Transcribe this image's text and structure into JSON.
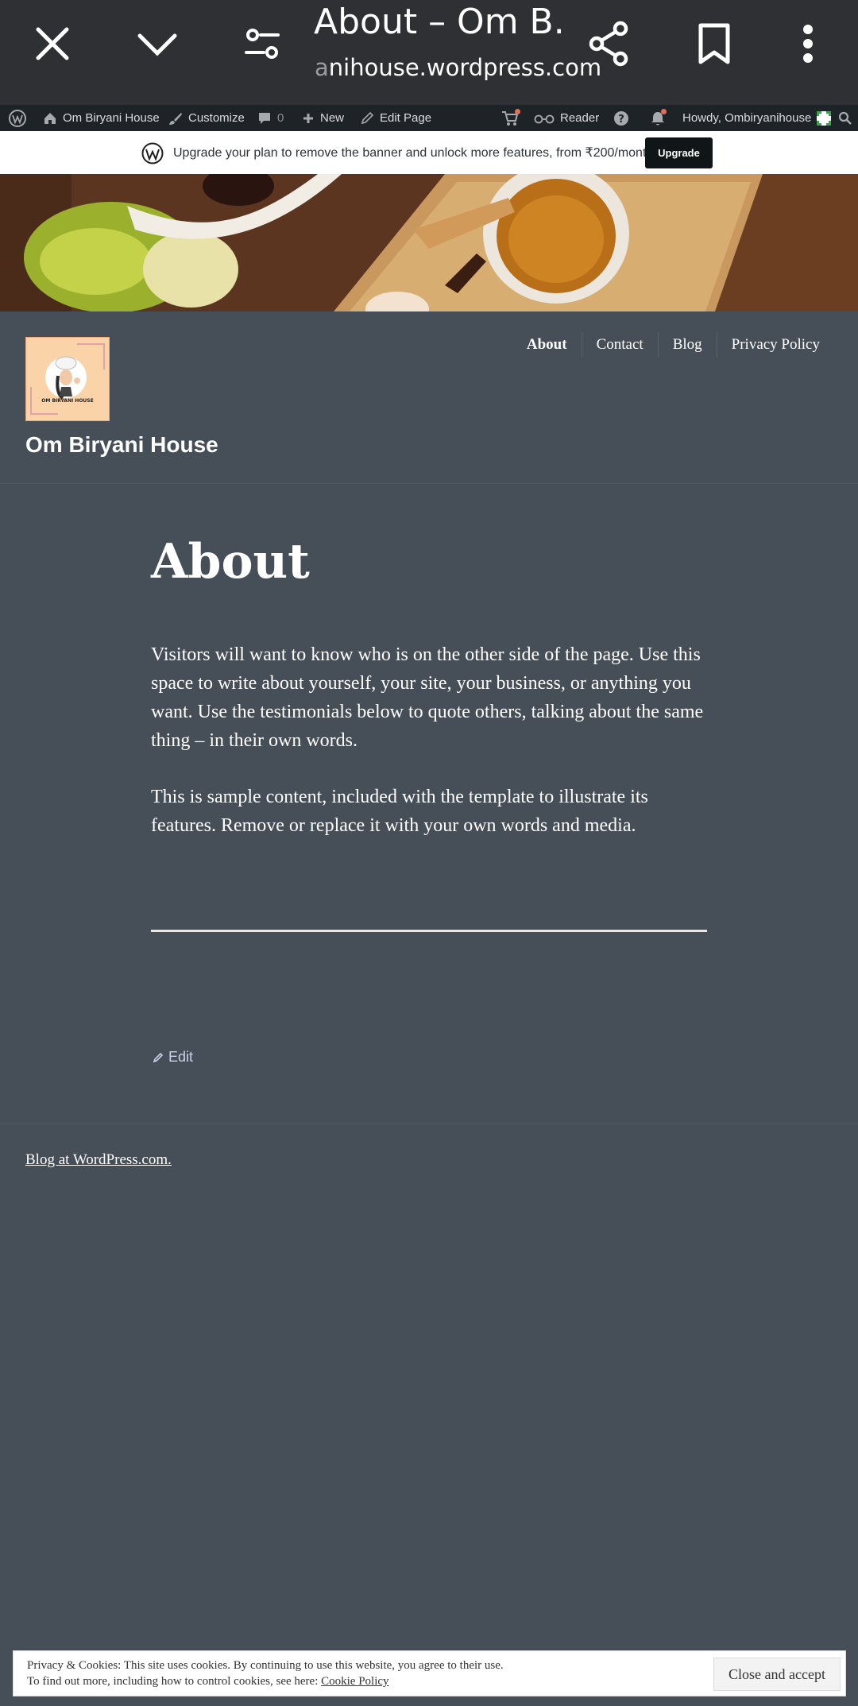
{
  "browser": {
    "title": "About – Om B...",
    "url_faded": "a",
    "url": "nihouse.wordpress.com",
    "icons": [
      "close-icon",
      "chevron-down-icon",
      "tune-icon",
      "share-icon",
      "bookmark-icon",
      "more-vert-icon"
    ]
  },
  "admin_bar": {
    "site_name": "Om Biryani House",
    "customize": "Customize",
    "comments_count": "0",
    "new": "New",
    "edit_page": "Edit Page",
    "reader": "Reader",
    "howdy": "Howdy, Ombiryanihouse"
  },
  "upgrade_banner": {
    "text": "Upgrade your plan to remove the banner and unlock more features, from ₹200/month",
    "button": "Upgrade"
  },
  "header": {
    "logo_text": "OM BIRYANI HOUSE",
    "site_title": "Om Biryani House",
    "nav": [
      "About",
      "Contact",
      "Blog",
      "Privacy Policy"
    ],
    "current_nav": "About"
  },
  "content": {
    "title": "About",
    "paragraphs": [
      "Visitors will want to know who is on the other side of the page. Use this space to write about yourself, your site, your business, or any­thing you want. Use the testimonials below to quote others, talking about the same thing – in their own words.",
      "This is sample content, included with the template to illustrate its features. Remove or replace it with your own words and media."
    ],
    "edit": "Edit"
  },
  "footer": {
    "link": "Blog at WordPress.com."
  },
  "cookie": {
    "line1": "Privacy & Cookies: This site uses cookies. By continuing to use this website, you agree to their use.",
    "line2": "To find out more, including how to control cookies, see here:",
    "policy_link": "Cookie Policy",
    "button": "Close and accept"
  },
  "colors": {
    "page_bg": "#464e58",
    "browser_bar": "#2e3034",
    "admin_bar": "#1e2327",
    "notification_dot": "#e26f56"
  }
}
